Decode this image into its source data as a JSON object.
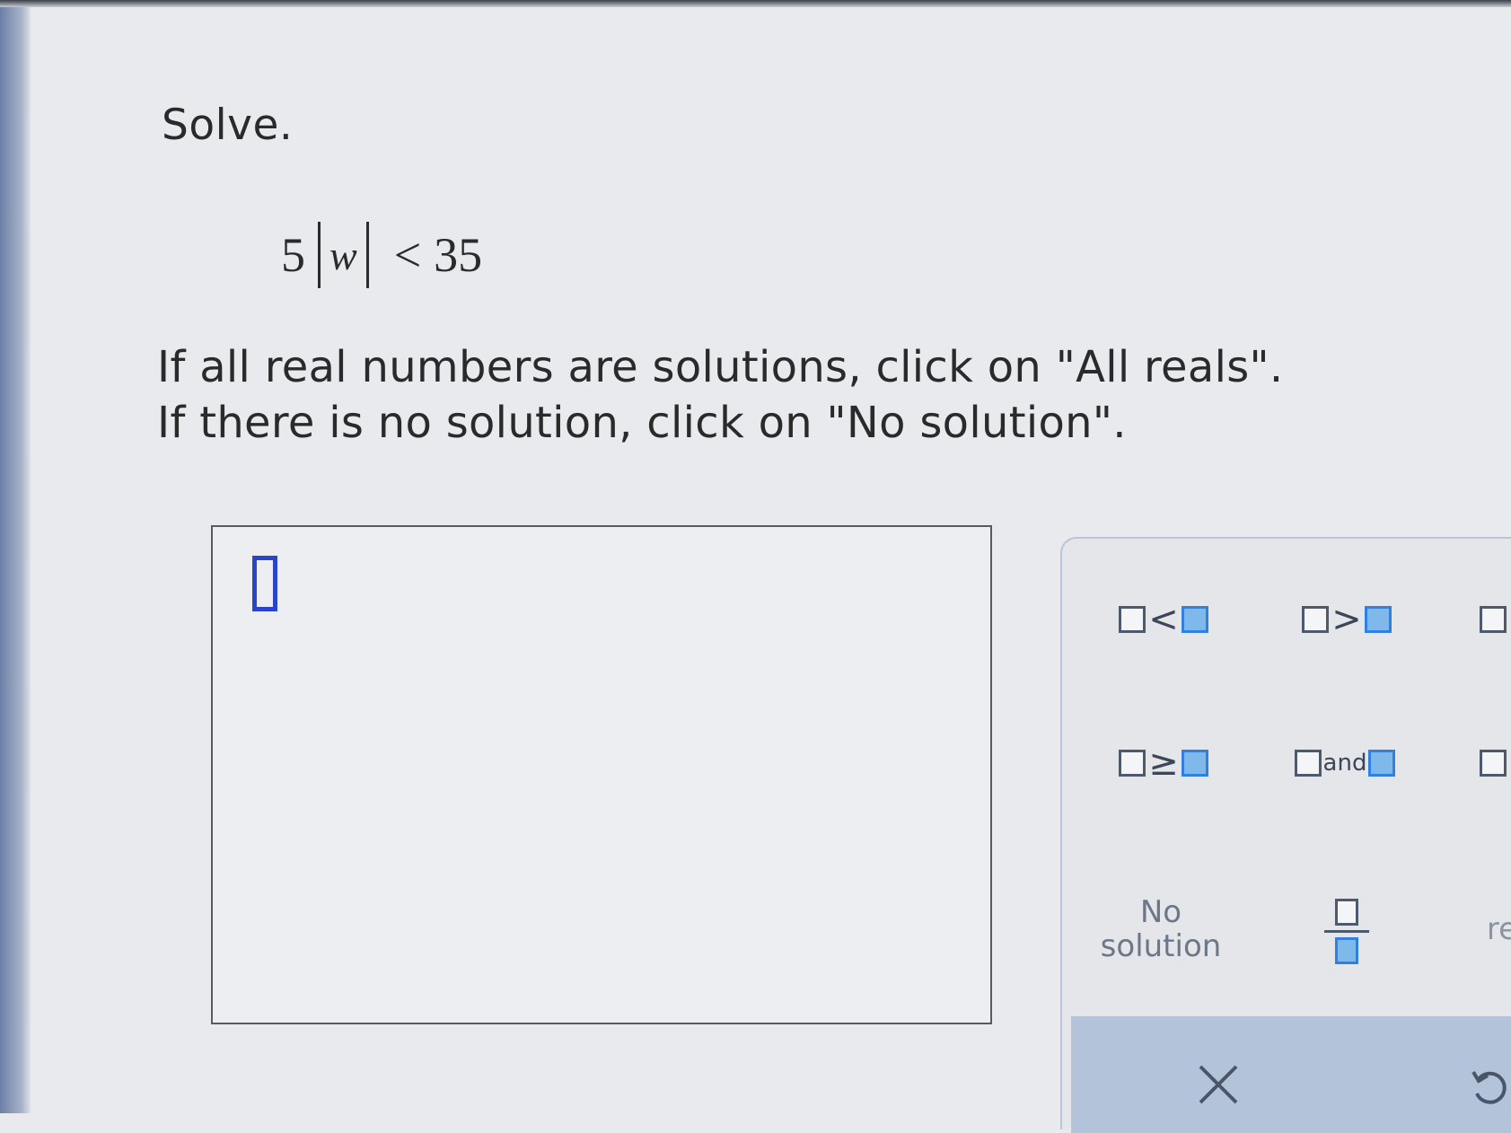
{
  "question": {
    "prompt": "Solve.",
    "equation": {
      "coefficient": "5",
      "variable": "w",
      "operator": "<",
      "rhs": "35"
    },
    "instruction_line1": "If all real numbers are solutions, click on \"All reals\".",
    "instruction_line2": "If there is no solution, click on \"No solution\"."
  },
  "keypad": {
    "less_than_symbol": "<",
    "greater_than_symbol": ">",
    "greater_equal_symbol": "≥",
    "and_label": "and",
    "no_solution_line1": "No",
    "no_solution_line2": "solution",
    "all_reals_partial": "re"
  },
  "colors": {
    "cursor": "#2a45c8",
    "blue_slot": "#7fb9ec",
    "bottom_bar": "#b3c3da"
  }
}
